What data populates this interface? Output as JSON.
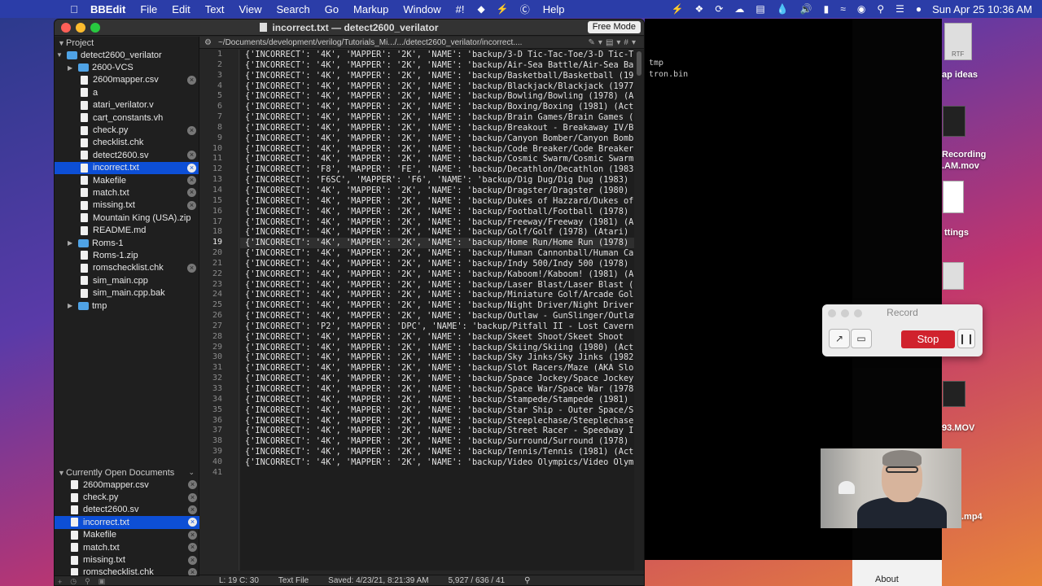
{
  "menubar": {
    "app_name": "BBEdit",
    "items": [
      "File",
      "Edit",
      "Text",
      "View",
      "Search",
      "Go",
      "Markup",
      "Window",
      "#!"
    ],
    "help": "Help",
    "clock": "Sun Apr 25  10:36 AM"
  },
  "window": {
    "title": "incorrect.txt — detect2600_verilator",
    "free_mode": "Free Mode",
    "path": "~/Documents/development/verilog/Tutorials_Mi.../.../detect2600_verilator/incorrect...."
  },
  "project": {
    "header": "Project",
    "root": "detect2600_verilator",
    "files": [
      {
        "name": "2600-VCS",
        "kind": "folder",
        "close": false
      },
      {
        "name": "2600mapper.csv",
        "kind": "file",
        "close": true
      },
      {
        "name": "a",
        "kind": "file",
        "close": false
      },
      {
        "name": "atari_verilator.v",
        "kind": "file",
        "close": false
      },
      {
        "name": "cart_constants.vh",
        "kind": "file",
        "close": false
      },
      {
        "name": "check.py",
        "kind": "file",
        "close": true
      },
      {
        "name": "checklist.chk",
        "kind": "file",
        "close": false
      },
      {
        "name": "detect2600.sv",
        "kind": "file",
        "close": true
      },
      {
        "name": "incorrect.txt",
        "kind": "file",
        "close": true,
        "selected": true
      },
      {
        "name": "Makefile",
        "kind": "file",
        "close": true
      },
      {
        "name": "match.txt",
        "kind": "file",
        "close": true
      },
      {
        "name": "missing.txt",
        "kind": "file",
        "close": true
      },
      {
        "name": "Mountain King (USA).zip",
        "kind": "file",
        "close": false
      },
      {
        "name": "README.md",
        "kind": "file",
        "close": false
      },
      {
        "name": "Roms-1",
        "kind": "folder",
        "close": false
      },
      {
        "name": "Roms-1.zip",
        "kind": "file",
        "close": false
      },
      {
        "name": "romschecklist.chk",
        "kind": "file",
        "close": true
      },
      {
        "name": "sim_main.cpp",
        "kind": "file",
        "close": false
      },
      {
        "name": "sim_main.cpp.bak",
        "kind": "file",
        "close": false
      },
      {
        "name": "tmp",
        "kind": "folder",
        "close": false
      }
    ]
  },
  "open_docs": {
    "header": "Currently Open Documents",
    "files": [
      {
        "name": "2600mapper.csv"
      },
      {
        "name": "check.py"
      },
      {
        "name": "detect2600.sv"
      },
      {
        "name": "incorrect.txt",
        "selected": true
      },
      {
        "name": "Makefile"
      },
      {
        "name": "match.txt"
      },
      {
        "name": "missing.txt"
      },
      {
        "name": "romschecklist.chk"
      }
    ]
  },
  "editor": {
    "current_line": 19,
    "lines": [
      "{'INCORRECT': '4K', 'MAPPER': '2K', 'NAME': 'backup/3-D Tic-Tac-Toe/3-D Tic-Tac-Toe",
      "{'INCORRECT': '4K', 'MAPPER': '2K', 'NAME': 'backup/Air-Sea Battle/Air-Sea Battle",
      "{'INCORRECT': '4K', 'MAPPER': '2K', 'NAME': 'backup/Basketball/Basketball (1978)",
      "{'INCORRECT': '4K', 'MAPPER': '2K', 'NAME': 'backup/Blackjack/Blackjack (1977)",
      "{'INCORRECT': '4K', 'MAPPER': '2K', 'NAME': 'backup/Bowling/Bowling (1978) (Atari)",
      "{'INCORRECT': '4K', 'MAPPER': '2K', 'NAME': 'backup/Boxing/Boxing (1981) (Activision)",
      "{'INCORRECT': '4K', 'MAPPER': '2K', 'NAME': 'backup/Brain Games/Brain Games (1978)",
      "{'INCORRECT': '4K', 'MAPPER': '2K', 'NAME': 'backup/Breakout - Breakaway IV/Breakout",
      "{'INCORRECT': '4K', 'MAPPER': '2K', 'NAME': 'backup/Canyon Bomber/Canyon Bomber",
      "{'INCORRECT': '4K', 'MAPPER': '2K', 'NAME': 'backup/Code Breaker/Code Breaker",
      "{'INCORRECT': '4K', 'MAPPER': '2K', 'NAME': 'backup/Cosmic Swarm/Cosmic Swarm",
      "{'INCORRECT': 'F8', 'MAPPER': 'FE', 'NAME': 'backup/Decathlon/Decathlon (1983)",
      "{'INCORRECT': 'F6SC', 'MAPPER': 'F6', 'NAME': 'backup/Dig Dug/Dig Dug (1983)",
      "{'INCORRECT': '4K', 'MAPPER': '2K', 'NAME': 'backup/Dragster/Dragster (1980)",
      "{'INCORRECT': '4K', 'MAPPER': '2K', 'NAME': 'backup/Dukes of Hazzard/Dukes of Hazzard",
      "{'INCORRECT': '4K', 'MAPPER': '2K', 'NAME': 'backup/Football/Football (1978)",
      "{'INCORRECT': '4K', 'MAPPER': '2K', 'NAME': 'backup/Freeway/Freeway (1981) (Activision)",
      "{'INCORRECT': '4K', 'MAPPER': '2K', 'NAME': 'backup/Golf/Golf (1978) (Atari)",
      "{'INCORRECT': '4K', 'MAPPER': '2K', 'NAME': 'backup/Home Run/Home Run (1978)",
      "{'INCORRECT': '4K', 'MAPPER': '2K', 'NAME': 'backup/Human Cannonball/Human Cannonball",
      "{'INCORRECT': '4K', 'MAPPER': '2K', 'NAME': 'backup/Indy 500/Indy 500 (1978)",
      "{'INCORRECT': '4K', 'MAPPER': '2K', 'NAME': 'backup/Kaboom!/Kaboom! (1981) (Activision)",
      "{'INCORRECT': '4K', 'MAPPER': '2K', 'NAME': 'backup/Laser Blast/Laser Blast (1981)",
      "{'INCORRECT': '4K', 'MAPPER': '2K', 'NAME': 'backup/Miniature Golf/Arcade Golf",
      "{'INCORRECT': '4K', 'MAPPER': '2K', 'NAME': 'backup/Night Driver/Night Driver",
      "{'INCORRECT': '4K', 'MAPPER': '2K', 'NAME': 'backup/Outlaw - GunSlinger/Outlaw",
      "{'INCORRECT': 'P2', 'MAPPER': 'DPC', 'NAME': 'backup/Pitfall II - Lost Caverns",
      "{'INCORRECT': '4K', 'MAPPER': '2K', 'NAME': 'backup/Skeet Shoot/Skeet Shoot",
      "{'INCORRECT': '4K', 'MAPPER': '2K', 'NAME': 'backup/Skiing/Skiing (1980) (Activision)",
      "{'INCORRECT': '4K', 'MAPPER': '2K', 'NAME': 'backup/Sky Jinks/Sky Jinks (1982)",
      "{'INCORRECT': '4K', 'MAPPER': '2K', 'NAME': 'backup/Slot Racers/Maze (AKA Slot Racers)",
      "{'INCORRECT': '4K', 'MAPPER': '2K', 'NAME': 'backup/Space Jockey/Space Jockey",
      "{'INCORRECT': '4K', 'MAPPER': '2K', 'NAME': 'backup/Space War/Space War (1978)",
      "{'INCORRECT': '4K', 'MAPPER': '2K', 'NAME': 'backup/Stampede/Stampede (1981)",
      "{'INCORRECT': '4K', 'MAPPER': '2K', 'NAME': 'backup/Star Ship - Outer Space/Star Ship",
      "{'INCORRECT': '4K', 'MAPPER': '2K', 'NAME': 'backup/Steeplechase/Steeplechase",
      "{'INCORRECT': '4K', 'MAPPER': '2K', 'NAME': 'backup/Street Racer - Speedway II",
      "{'INCORRECT': '4K', 'MAPPER': '2K', 'NAME': 'backup/Surround/Surround (1978)",
      "{'INCORRECT': '4K', 'MAPPER': '2K', 'NAME': 'backup/Tennis/Tennis (1981) (Activision)",
      "{'INCORRECT': '4K', 'MAPPER': '2K', 'NAME': 'backup/Video Olympics/Video Olympics",
      ""
    ]
  },
  "status": {
    "position": "L: 19 C: 30",
    "type": "Text File",
    "saved": "Saved: 4/23/21, 8:21:39 AM",
    "counts": "5,927 / 636 / 41"
  },
  "terminal": {
    "lines": [
      "tmp",
      "tron.bin"
    ]
  },
  "desktop": {
    "items": [
      "ap ideas",
      "Recording",
      ".AM.mov",
      "ttings",
      "93.MOV",
      ".mp4"
    ],
    "rtf_label": "RTF"
  },
  "record": {
    "title": "Record",
    "stop": "Stop"
  },
  "about": "About"
}
